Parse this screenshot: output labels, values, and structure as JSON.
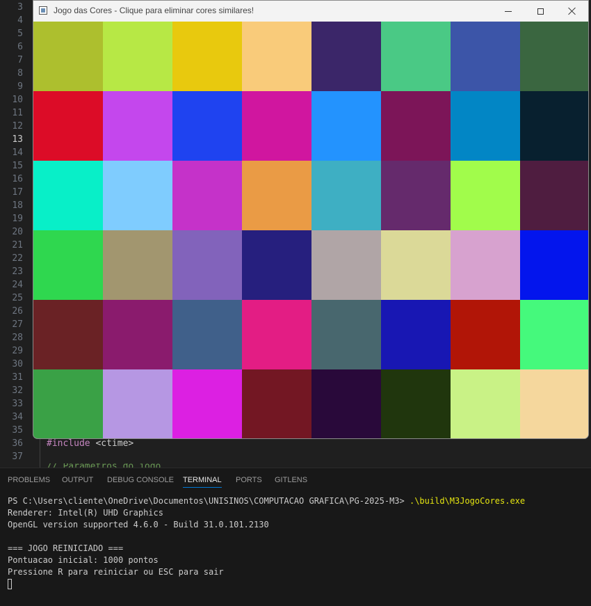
{
  "editor": {
    "line_numbers": [
      "3",
      "4",
      "5",
      "6",
      "7",
      "8",
      "9",
      "10",
      "11",
      "12",
      "13",
      "14",
      "15",
      "16",
      "17",
      "18",
      "19",
      "20",
      "21",
      "22",
      "23",
      "24",
      "25",
      "26",
      "27",
      "28",
      "29",
      "30",
      "31",
      "32",
      "33",
      "34",
      "35",
      "36",
      "37"
    ],
    "active_line": "13",
    "code": {
      "line36_directive": "#include",
      "line36_header": " <ctime>",
      "line38_partial": "// Parâmetros do jogo"
    }
  },
  "game_window": {
    "title": "Jogo das Cores - Clique para eliminar cores similares!",
    "icons": {
      "app": "app-window-icon",
      "minimize": "minimize-icon",
      "maximize": "maximize-icon",
      "close": "close-icon"
    },
    "grid": {
      "columns": 8,
      "rows": 6,
      "colors": [
        [
          "#adbf2e",
          "#b7e845",
          "#e8c90e",
          "#f9cb7a",
          "#3b2669",
          "#4ac985",
          "#3c55a8",
          "#3a6640"
        ],
        [
          "#dc0c27",
          "#c447ed",
          "#1f43f0",
          "#d0169f",
          "#2393fe",
          "#7c1558",
          "#0286c5",
          "#08202f"
        ],
        [
          "#08efc8",
          "#7fccfe",
          "#c532c9",
          "#ea9b45",
          "#3eafc3",
          "#652a6c",
          "#a1fc4b",
          "#4f1d40"
        ],
        [
          "#2fd74f",
          "#a2966f",
          "#8263bb",
          "#261f7e",
          "#b0a5a6",
          "#dbd998",
          "#d7a2cf",
          "#0315ed"
        ],
        [
          "#6a2225",
          "#8a1b6d",
          "#40608a",
          "#e31d84",
          "#48676e",
          "#1817b3",
          "#b11507",
          "#45f97c"
        ],
        [
          "#3aa146",
          "#b697e3",
          "#dc20e2",
          "#731723",
          "#29093a",
          "#20360d",
          "#c9f286",
          "#f5d79d"
        ]
      ]
    }
  },
  "panel": {
    "tabs": [
      "PROBLEMS",
      "OUTPUT",
      "DEBUG CONSOLE",
      "TERMINAL",
      "PORTS",
      "GITLENS"
    ],
    "active_tab": "TERMINAL",
    "terminal": {
      "prompt": "PS C:\\Users\\cliente\\OneDrive\\Documentos\\UNISINOS\\COMPUTACAO GRAFICA\\PG-2025-M3> ",
      "command": ".\\build\\M3JogoCores.exe",
      "renderer": "Renderer: Intel(R) UHD Graphics",
      "opengl": "OpenGL version supported 4.6.0 - Build 31.0.101.2130",
      "blank": "",
      "restart": "=== JOGO REINICIADO ===",
      "score": "Pontuacao inicial: 1000 pontos",
      "instructions": "Pressione R para reiniciar ou ESC para sair"
    }
  }
}
